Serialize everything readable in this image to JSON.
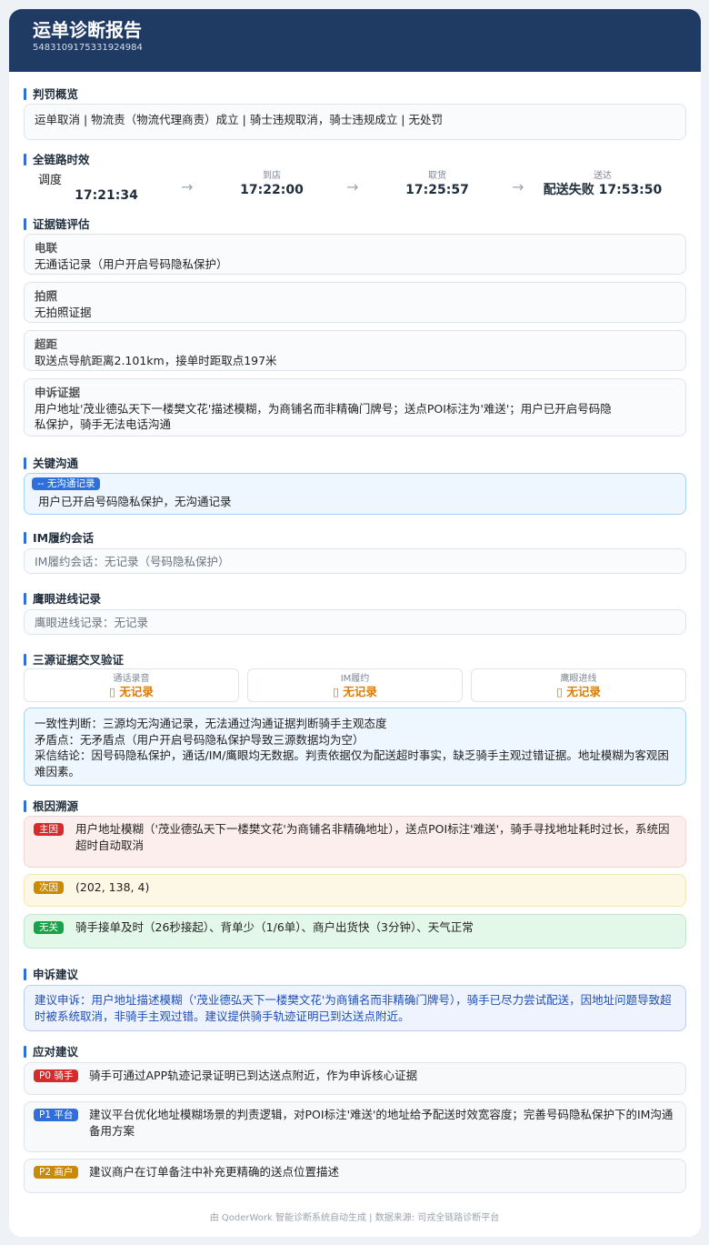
{
  "header": {
    "title": "运单诊断报告",
    "waybill_id": "5483109175331924984"
  },
  "penalty": {
    "section": "判罚概览",
    "text": "运单取消 | 物流责（物流代理商责）成立 | 骑士违规取消，骑士违规成立 | 无处罚"
  },
  "timeline": {
    "section": "全链路时效",
    "steps": [
      {
        "label": "调度",
        "time": "17:21:34"
      },
      {
        "label": "到店",
        "time": "17:22:00"
      },
      {
        "label": "取货",
        "time": "17:25:57"
      },
      {
        "label": "送达",
        "time": "配送失败 17:53:50"
      }
    ],
    "arrow": "→"
  },
  "evidence": {
    "section": "证据链评估",
    "items": [
      {
        "title": "电联",
        "text": "无通话记录（用户开启号码隐私保护）"
      },
      {
        "title": "拍照",
        "text": "无拍照证据"
      },
      {
        "title": "超距",
        "text": "取送点导航距离2.101km，接单时距取点197米"
      },
      {
        "title": "申诉证据",
        "text": "用户地址'茂业德弘天下一楼樊文花'描述模糊，为商铺名而非精确门牌号；送点POI标注为'难送'；用户已开启号码隐私保护，骑手无法电话沟通"
      }
    ]
  },
  "comm": {
    "section": "关键沟通",
    "badge": "-- 无沟通记录",
    "text": "用户已开启号码隐私保护，无沟通记录"
  },
  "im": {
    "section": "IM履约会话",
    "text": "IM履约会话：无记录（号码隐私保护）"
  },
  "eagle": {
    "section": "鹰眼进线记录",
    "text": "鹰眼进线记录：无记录"
  },
  "triple": {
    "section": "三源证据交叉验证",
    "sources": [
      {
        "label": "通话录音",
        "value": "▯ 无记录"
      },
      {
        "label": "IM履约",
        "value": "▯ 无记录"
      },
      {
        "label": "鹰眼进线",
        "value": "▯ 无记录"
      }
    ],
    "consistency": "一致性判断：三源均无沟通记录，无法通过沟通证据判断骑手主观态度",
    "conflict": "矛盾点：无矛盾点（用户开启号码隐私保护导致三源数据均为空）",
    "conclusion": "采信结论：因号码隐私保护，通话/IM/鹰眼均无数据。判责依据仅为配送超时事实，缺乏骑手主观过错证据。地址模糊为客观困难因素。"
  },
  "root": {
    "section": "根因溯源",
    "items": [
      {
        "badge": "主因",
        "text": "用户地址模糊（'茂业德弘天下一楼樊文花'为商铺名非精确地址），送点POI标注'难送'，骑手寻找地址耗时过长，系统因超时自动取消",
        "color": "#d52b2b"
      },
      {
        "badge": "次因",
        "text": "(202, 138, 4)",
        "color": "#ca8a04"
      },
      {
        "badge": "无关",
        "text": "骑手接单及时（26秒接起）、背单少（1/6单）、商户出货快（3分钟）、天气正常",
        "color": "#16a34a"
      }
    ]
  },
  "appeal": {
    "section": "申诉建议",
    "text": "建议申诉：用户地址描述模糊（'茂业德弘天下一楼樊文花'为商铺名而非精确门牌号），骑手已尽力尝试配送，因地址问题导致超时被系统取消，非骑手主观过错。建议提供骑手轨迹证明已到达送点附近。"
  },
  "actions": {
    "section": "应对建议",
    "items": [
      {
        "badge": "P0 骑手",
        "text": "骑手可通过APP轨迹记录证明已到达送点附近，作为申诉核心证据",
        "color": "#d52b2b"
      },
      {
        "badge": "P1 平台",
        "text": "建议平台优化地址模糊场景的判责逻辑，对POI标注'难送'的地址给予配送时效宽容度；完善号码隐私保护下的IM沟通备用方案",
        "color": "#2f6fdb"
      },
      {
        "badge": "P2 商户",
        "text": "建议商户在订单备注中补充更精确的送点位置描述",
        "color": "#ca8a04"
      }
    ]
  },
  "footer": "由 QoderWork 智能诊断系统自动生成 | 数据来源: 司戎全链路诊断平台"
}
